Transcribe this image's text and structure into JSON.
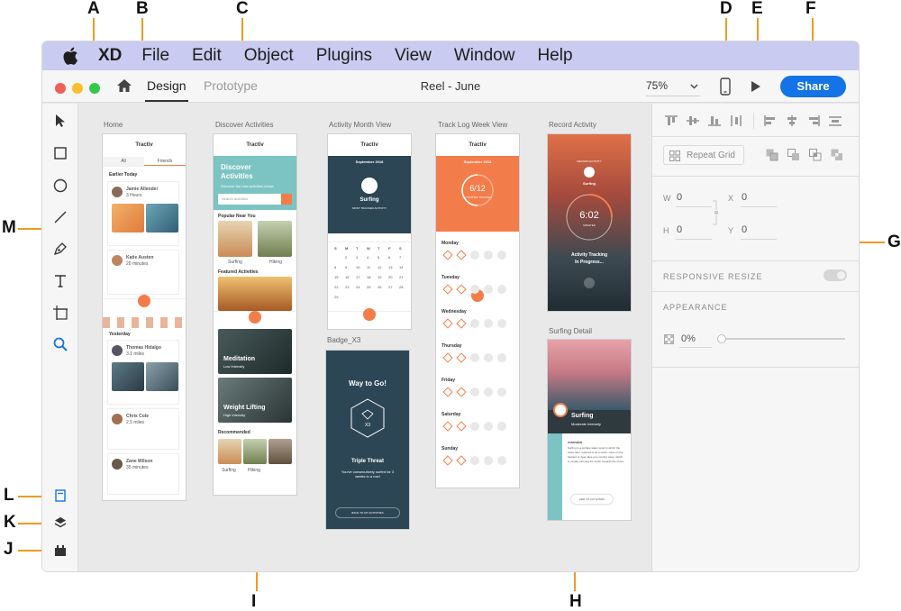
{
  "callouts": {
    "A": "A",
    "B": "B",
    "C": "C",
    "D": "D",
    "E": "E",
    "F": "F",
    "G": "G",
    "H": "H",
    "I": "I",
    "J": "J",
    "K": "K",
    "L": "L",
    "M": "M"
  },
  "menubar": {
    "items": [
      "XD",
      "File",
      "Edit",
      "Object",
      "Plugins",
      "View",
      "Window",
      "Help"
    ]
  },
  "titlebar": {
    "tab_design": "Design",
    "tab_prototype": "Prototype",
    "document_title": "Reel - June",
    "zoom": "75%",
    "share_label": "Share"
  },
  "colors": {
    "accent": "#1473e6",
    "orange": "#f37d4a",
    "teal": "#7cc4c3",
    "navy": "#2d4655",
    "callout_line": "#f29a1f",
    "menubar": "#c9cbf0"
  },
  "artboards": {
    "home": {
      "label": "Home",
      "brand": "Tractiv",
      "tab_all": "All",
      "tab_friends": "Friends",
      "section_earlier": "Earlier Today",
      "section_yesterday": "Yesterday",
      "post1_name": "Jamie Allender",
      "post1_time": "3 Hours",
      "post2_name": "Katie Austen",
      "post2_time": "20 minutes",
      "post3_name": "Thomas Hidalgo",
      "post3_time": "3.1 miles",
      "post4_name": "Chris Cole",
      "post4_time": "2.5 miles",
      "post5_name": "Zane Wilson",
      "post5_time": "35 minutes"
    },
    "discover": {
      "label": "Discover Activities",
      "brand": "Tractiv",
      "hero_title_1": "Discover",
      "hero_title_2": "Activities",
      "hero_sub": "Discover fun new activities below",
      "search_placeholder": "Search activities",
      "popular": "Popular Near You",
      "surfing": "Surfing",
      "hiking": "Hiking",
      "featured": "Featured Activities",
      "meditation": "Meditation",
      "meditation_sub": "Low Intensity",
      "weight": "Weight Lifting",
      "weight_sub": "High Intensity",
      "recommended": "Recommended"
    },
    "month": {
      "label": "Activity Month View",
      "brand": "Tractiv",
      "month_title": "September 2018",
      "activity": "Surfing",
      "activity_sub": "MOST TRACKED ACTIVITY",
      "weekdays": [
        "S",
        "M",
        "T",
        "W",
        "T",
        "F",
        "S"
      ],
      "dates": [
        "2",
        "3",
        "4",
        "5",
        "6",
        "7",
        "8",
        "9",
        "10",
        "11",
        "12",
        "13",
        "14",
        "15",
        "16",
        "17",
        "18",
        "19",
        "20",
        "21",
        "22",
        "23",
        "24",
        "25",
        "26",
        "27",
        "28",
        "29"
      ]
    },
    "badge": {
      "label": "Badge_X3",
      "title": "Way to Go!",
      "badge_text": "X3",
      "threat": "Triple Threat",
      "desc": "You've consecutively surfed for 3 weeks in a row!",
      "button": "BACK TO MY ACTIVITIES"
    },
    "week": {
      "label": "Track Log Week View",
      "brand": "Tractiv",
      "month_title": "September 2018",
      "progress": "6/12",
      "progress_sub": "ACTIVITIES TRACKED",
      "days": [
        "Monday",
        "Tuesday",
        "Wednesday",
        "Thursday",
        "Friday",
        "Saturday",
        "Sunday"
      ]
    },
    "record": {
      "label": "Record Activity",
      "top_text": "RECORD ACTIVITY",
      "activity": "Surfing",
      "time": "6:02",
      "time_unit": "MINUTES",
      "status_1": "Activity Tracking",
      "status_2": "In Progress..."
    },
    "detail": {
      "label": "Surfing Detail",
      "title": "Surfing",
      "subtitle": "Moderate Intensity",
      "overview": "OVERVIEW",
      "body": "Surfing is a surface water sport in which the wave rider, referred to as a surfer, rides on the forward or deep face of a moving wave, which is usually carrying the surfer towards the shore.",
      "button": "ADD TO ACTIVITIES"
    }
  },
  "inspector": {
    "repeat_grid": "Repeat Grid",
    "w_label": "W",
    "w_value": "0",
    "h_label": "H",
    "h_value": "0",
    "x_label": "X",
    "x_value": "0",
    "y_label": "Y",
    "y_value": "0",
    "responsive_resize": "RESPONSIVE RESIZE",
    "appearance": "APPEARANCE",
    "opacity": "0%"
  }
}
